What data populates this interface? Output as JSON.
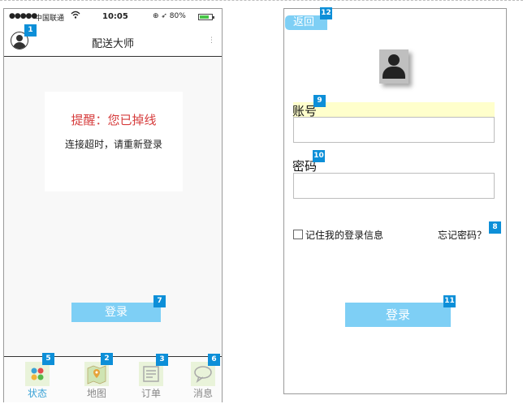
{
  "left_screen": {
    "status_bar": {
      "signal": "●●●●●",
      "carrier": "中国联通",
      "wifi_icon": "wifi-icon",
      "time": "10:05",
      "right_info": "⊕ ➶ 80%",
      "battery_icon": "battery-icon"
    },
    "nav": {
      "title": "配送大师",
      "dots": "⋮"
    },
    "alert": {
      "title": "提醒：您已掉线",
      "message": "连接超时，请重新登录"
    },
    "login_button": "登录",
    "tabs": [
      {
        "label": "状态",
        "icon": "status-icon",
        "active": true
      },
      {
        "label": "地图",
        "icon": "map-icon"
      },
      {
        "label": "订单",
        "icon": "order-icon"
      },
      {
        "label": "消息",
        "icon": "message-icon"
      }
    ]
  },
  "right_screen": {
    "back_button": "返回",
    "account_label": "账号",
    "account_value": "",
    "password_label": "密码",
    "password_value": "",
    "remember_label": "记住我的登录信息",
    "forgot_label": "忘记密码？",
    "login_button": "登录"
  },
  "badges": {
    "avatar": "1",
    "tab_map": "2",
    "tab_order": "3",
    "tab_status": "5",
    "tab_message": "6",
    "login_left": "7",
    "forgot": "8",
    "account": "9",
    "password": "10",
    "login_right": "11",
    "back": "12"
  },
  "colors": {
    "accent": "#7ecff5",
    "badge": "#0d8fd8",
    "alert_red": "#d63c3c",
    "label_highlight": "#ffffcc"
  }
}
